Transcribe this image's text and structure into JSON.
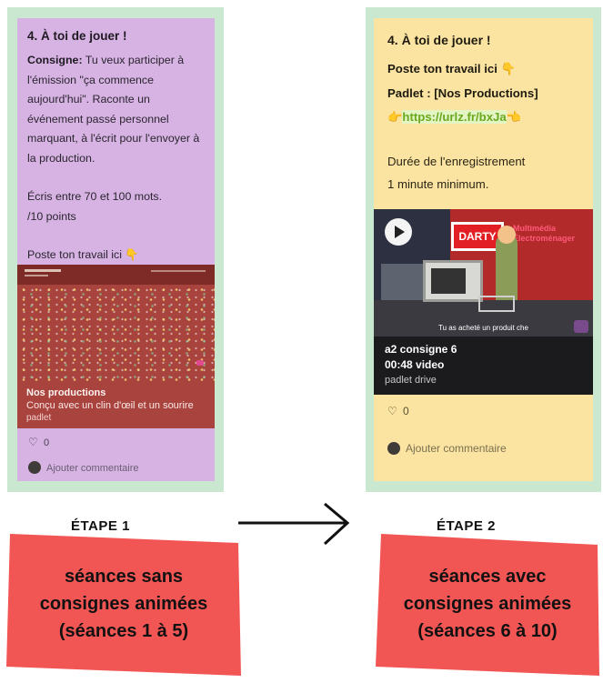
{
  "card1": {
    "title": "4. À toi de jouer !",
    "consigne_label": "Consigne:",
    "consigne_text": " Tu veux participer à l'émission \"ça commence aujourd'hui\". Raconte un événement passé personnel marquant, à l'écrit pour l'envoyer à la production.",
    "words": "Écris entre 70 et 100 mots.",
    "points": "/10 points",
    "post_here": "Poste ton travail ici 👇",
    "preview": {
      "title": "Nos productions",
      "description": "Conçu avec un clin d'œil et un sourire",
      "source": "padlet",
      "background": "#a9433e"
    },
    "likes": "0",
    "comment": "Ajouter commentaire",
    "background": "#d6b3e3"
  },
  "card2": {
    "title": "4. À toi de jouer !",
    "post_here": "Poste ton travail ici 👇",
    "padlet_line": "Padlet : [Nos Productions]",
    "link_prefix": "👉",
    "link": "https://urlz.fr/bxJa",
    "link_suffix": "👈",
    "duration_label": "Durée de l'enregistrement",
    "duration_value": "1 minute minimum.",
    "video": {
      "store_logo": "DARTY",
      "store_sign": "Multimédia Électroménager",
      "subtitle": "Tu as acheté un produit che",
      "title": "a2 consigne 6",
      "duration": "00:48 video",
      "source": "padlet drive"
    },
    "likes": "0",
    "comment": "Ajouter commentaire",
    "background": "#fbe4a2"
  },
  "steps": {
    "step1": "ÉTAPE 1",
    "step2": "ÉTAPE 2"
  },
  "banners": {
    "banner1": [
      "séances sans",
      "consignes animées",
      "(séances 1 à 5)"
    ],
    "banner2": [
      "séances avec",
      "consignes animées",
      "(séances 6 à 10)"
    ],
    "color": "#f25654"
  },
  "icons": {
    "arrow": "arrow-right-icon",
    "heart": "heart-icon",
    "play": "play-icon",
    "avatar": "avatar-icon"
  }
}
